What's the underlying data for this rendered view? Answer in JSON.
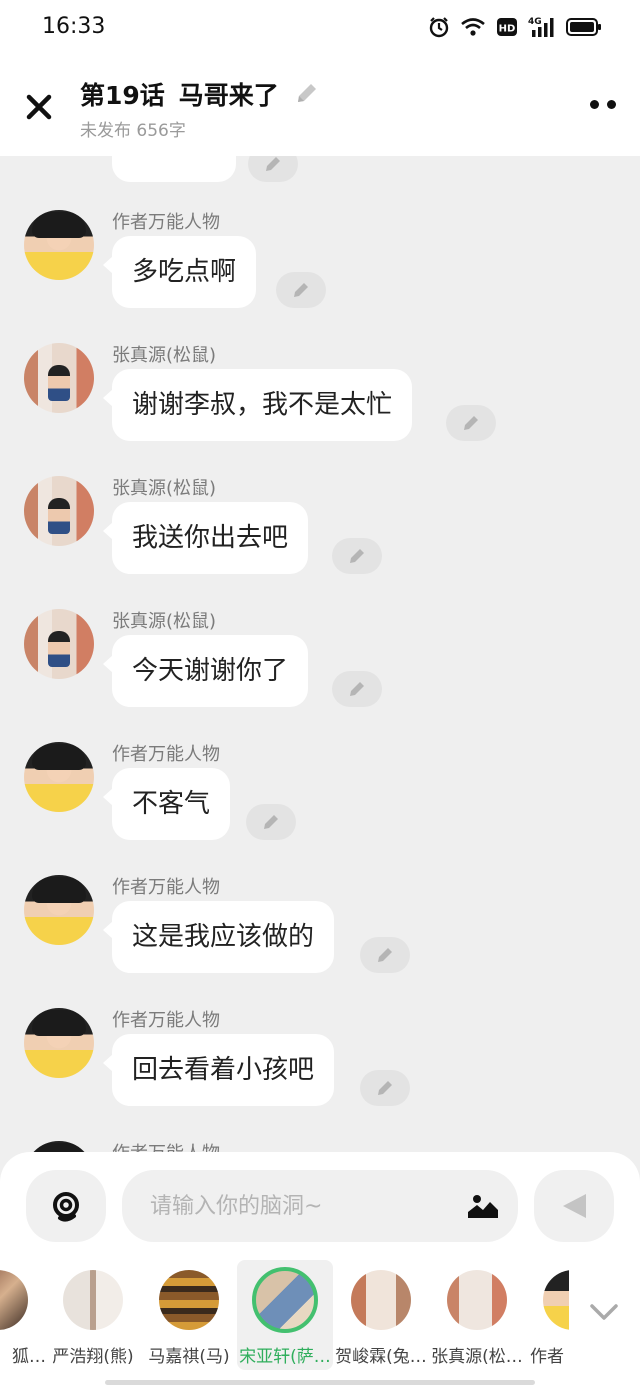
{
  "status_bar": {
    "time": "16:33",
    "icons": [
      "alarm-icon",
      "wifi-icon",
      "hd-icon",
      "4g-signal-icon",
      "battery-icon"
    ],
    "hd_label": "HD",
    "network_label": "4G"
  },
  "header": {
    "title_episode": "第19话",
    "title_name": "马哥来了",
    "subtitle": "未发布 656字"
  },
  "messages": [
    {
      "speaker": "作者万能人物",
      "text": "多吃点啊"
    },
    {
      "speaker": "张真源(松鼠)",
      "text": "谢谢李叔，我不是太忙"
    },
    {
      "speaker": "张真源(松鼠)",
      "text": "我送你出去吧"
    },
    {
      "speaker": "张真源(松鼠)",
      "text": "今天谢谢你了"
    },
    {
      "speaker": "作者万能人物",
      "text": "不客气"
    },
    {
      "speaker": "作者万能人物",
      "text": "这是我应该做的"
    },
    {
      "speaker": "作者万能人物",
      "text": "回去看着小孩吧"
    },
    {
      "speaker": "作者万能人物",
      "text": ""
    }
  ],
  "composer": {
    "placeholder": "请输入你的脑洞~"
  },
  "roles": [
    {
      "label": "狐…"
    },
    {
      "label": "严浩翔(熊)"
    },
    {
      "label": "马嘉祺(马)"
    },
    {
      "label": "宋亚轩(萨…",
      "selected": true
    },
    {
      "label": "贺峻霖(兔…"
    },
    {
      "label": "张真源(松…"
    },
    {
      "label": "作者"
    }
  ],
  "colors": {
    "accent_green": "#43c06f",
    "background": "#efefef"
  }
}
